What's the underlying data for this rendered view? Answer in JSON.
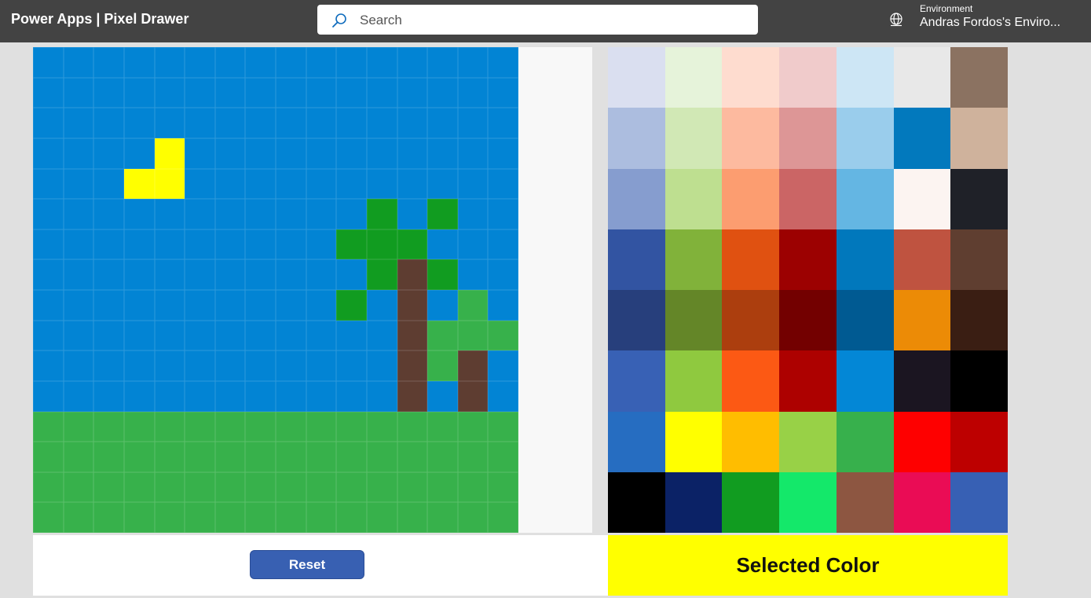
{
  "header": {
    "app_title": "Power Apps  |  Pixel Drawer",
    "search_placeholder": "Search",
    "environment_label": "Environment",
    "environment_name": "Andras Fordos's Enviro..."
  },
  "canvas": {
    "columns": 16,
    "rows": 16,
    "key": {
      "B": "#0284d4",
      "Y": "#ffff00",
      "D": "#119c20",
      "T": "#5e3d31",
      "G": "#37b14b"
    },
    "pixels": [
      "BBBBBBBBBBBBBBBB",
      "BBBBBBBBBBBBBBBB",
      "BBBBBBBBBBBBBBBB",
      "BBBBYBBBBBBBBBBB",
      "BBBYYBBBBBBBBBBB",
      "BBBBBBBBBBBDBDBB",
      "BBBBBBBBBBDDDBBB",
      "BBBBBBBBBBBDTDBB",
      "BBBBBBBBBBDBTBGB",
      "BBBBBBBBBBBBTGGG",
      "BBBBBBBBBBBBTGTB",
      "BBBBBBBBBBBBTBTB",
      "GGGGGGGGGGGGGGGG",
      "GGGGGGGGGGGGGGGG",
      "GGGGGGGGGGGGGGGG",
      "GGGGGGGGGGGGGGGG"
    ]
  },
  "palette": {
    "columns": 7,
    "colors": [
      "#dadff0",
      "#e6f3da",
      "#fedccf",
      "#f0cbcb",
      "#cde6f5",
      "#e8e8e8",
      "#8b7261",
      "#acbddf",
      "#d1e8b5",
      "#fdba9f",
      "#dd9696",
      "#9acdec",
      "#0279bd",
      "#cfb29c",
      "#869dcf",
      "#bedf90",
      "#fc9d70",
      "#cb6565",
      "#64b6e3",
      "#fcf4f1",
      "#1f2128",
      "#3254a2",
      "#81b23a",
      "#e05111",
      "#9c0101",
      "#0178bc",
      "#bf5340",
      "#5f3e30",
      "#273f7c",
      "#648628",
      "#ac3e0e",
      "#730000",
      "#005a92",
      "#ec8b06",
      "#3a1e13",
      "#3861b5",
      "#8fc93f",
      "#fc5914",
      "#ad0100",
      "#0387d6",
      "#1b1521",
      "#000000",
      "#266dc1",
      "#ffff00",
      "#ffbd00",
      "#98d147",
      "#37b04c",
      "#fe0000",
      "#bd0000",
      "#000000",
      "#0b2266",
      "#119c20",
      "#14e86a",
      "#8d5641",
      "#ea0c55",
      "#3760b4"
    ]
  },
  "controls": {
    "reset_label": "Reset"
  },
  "selected": {
    "label": "Selected Color",
    "color": "#ffff00"
  }
}
